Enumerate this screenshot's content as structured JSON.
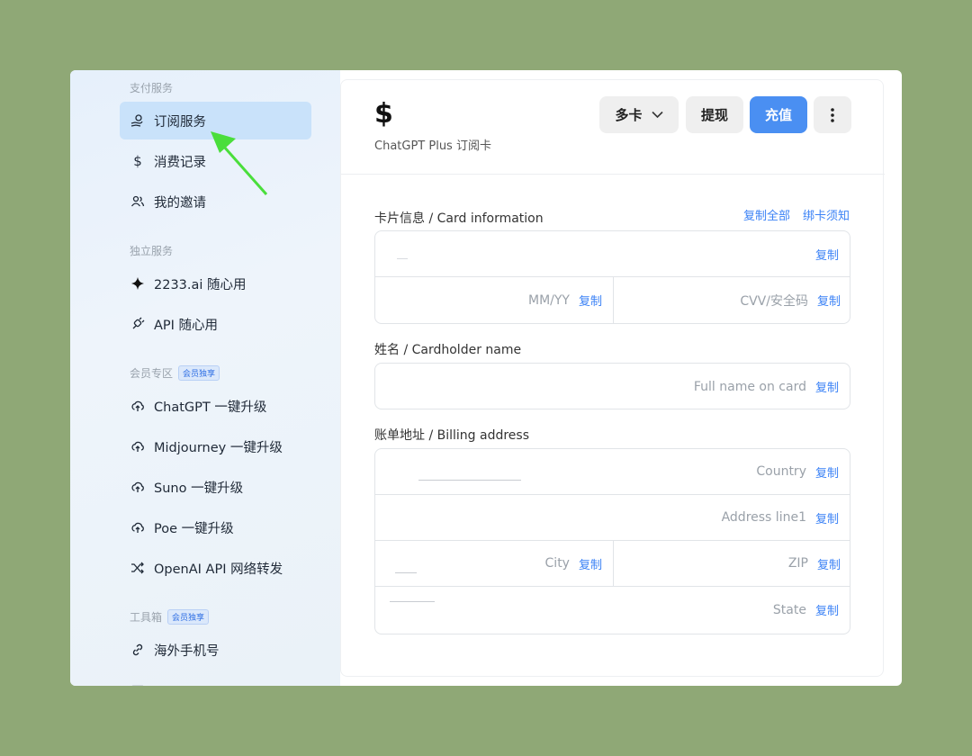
{
  "sidebar": {
    "sections": [
      {
        "title": "支付服务",
        "badge": null
      },
      {
        "title": "独立服务",
        "badge": null
      },
      {
        "title": "会员专区",
        "badge": "会员独享"
      },
      {
        "title": "工具箱",
        "badge": "会员独享"
      }
    ],
    "items": [
      {
        "label": "订阅服务",
        "icon": "hand-coin-icon"
      },
      {
        "label": "消费记录",
        "icon": "dollar-icon"
      },
      {
        "label": "我的邀请",
        "icon": "users-icon"
      },
      {
        "label": "2233.ai 随心用",
        "icon": "sparkle-icon"
      },
      {
        "label": "API 随心用",
        "icon": "plug-icon"
      },
      {
        "label": "ChatGPT 一键升级",
        "icon": "cloud-upload-icon"
      },
      {
        "label": "Midjourney 一键升级",
        "icon": "cloud-upload-icon"
      },
      {
        "label": "Suno 一键升级",
        "icon": "cloud-upload-icon"
      },
      {
        "label": "Poe 一键升级",
        "icon": "cloud-upload-icon"
      },
      {
        "label": "OpenAI API 网络转发",
        "icon": "shuffle-icon"
      },
      {
        "label": "海外手机号",
        "icon": "link-icon"
      }
    ]
  },
  "header": {
    "balance": "$",
    "card_type": "ChatGPT Plus 订阅卡",
    "multi_card": "多卡",
    "withdraw": "提现",
    "recharge": "充值"
  },
  "card_info": {
    "label": "卡片信息 / Card information",
    "copy_all": "复制全部",
    "binding_notice": "绑卡须知",
    "expiry_placeholder": "MM/YY",
    "cvv_placeholder": "CVV/安全码"
  },
  "cardholder": {
    "label": "姓名 / Cardholder name",
    "placeholder": "Full name on card"
  },
  "billing": {
    "label": "账单地址 / Billing address",
    "country": "Country",
    "address1": "Address line1",
    "city": "City",
    "zip": "ZIP",
    "state": "State"
  },
  "copy_label": "复制",
  "colors": {
    "accent": "#3b82f6",
    "primary_button": "#4a8ff2",
    "active_nav": "#c9e2fa",
    "arrow": "#4ade3b"
  }
}
